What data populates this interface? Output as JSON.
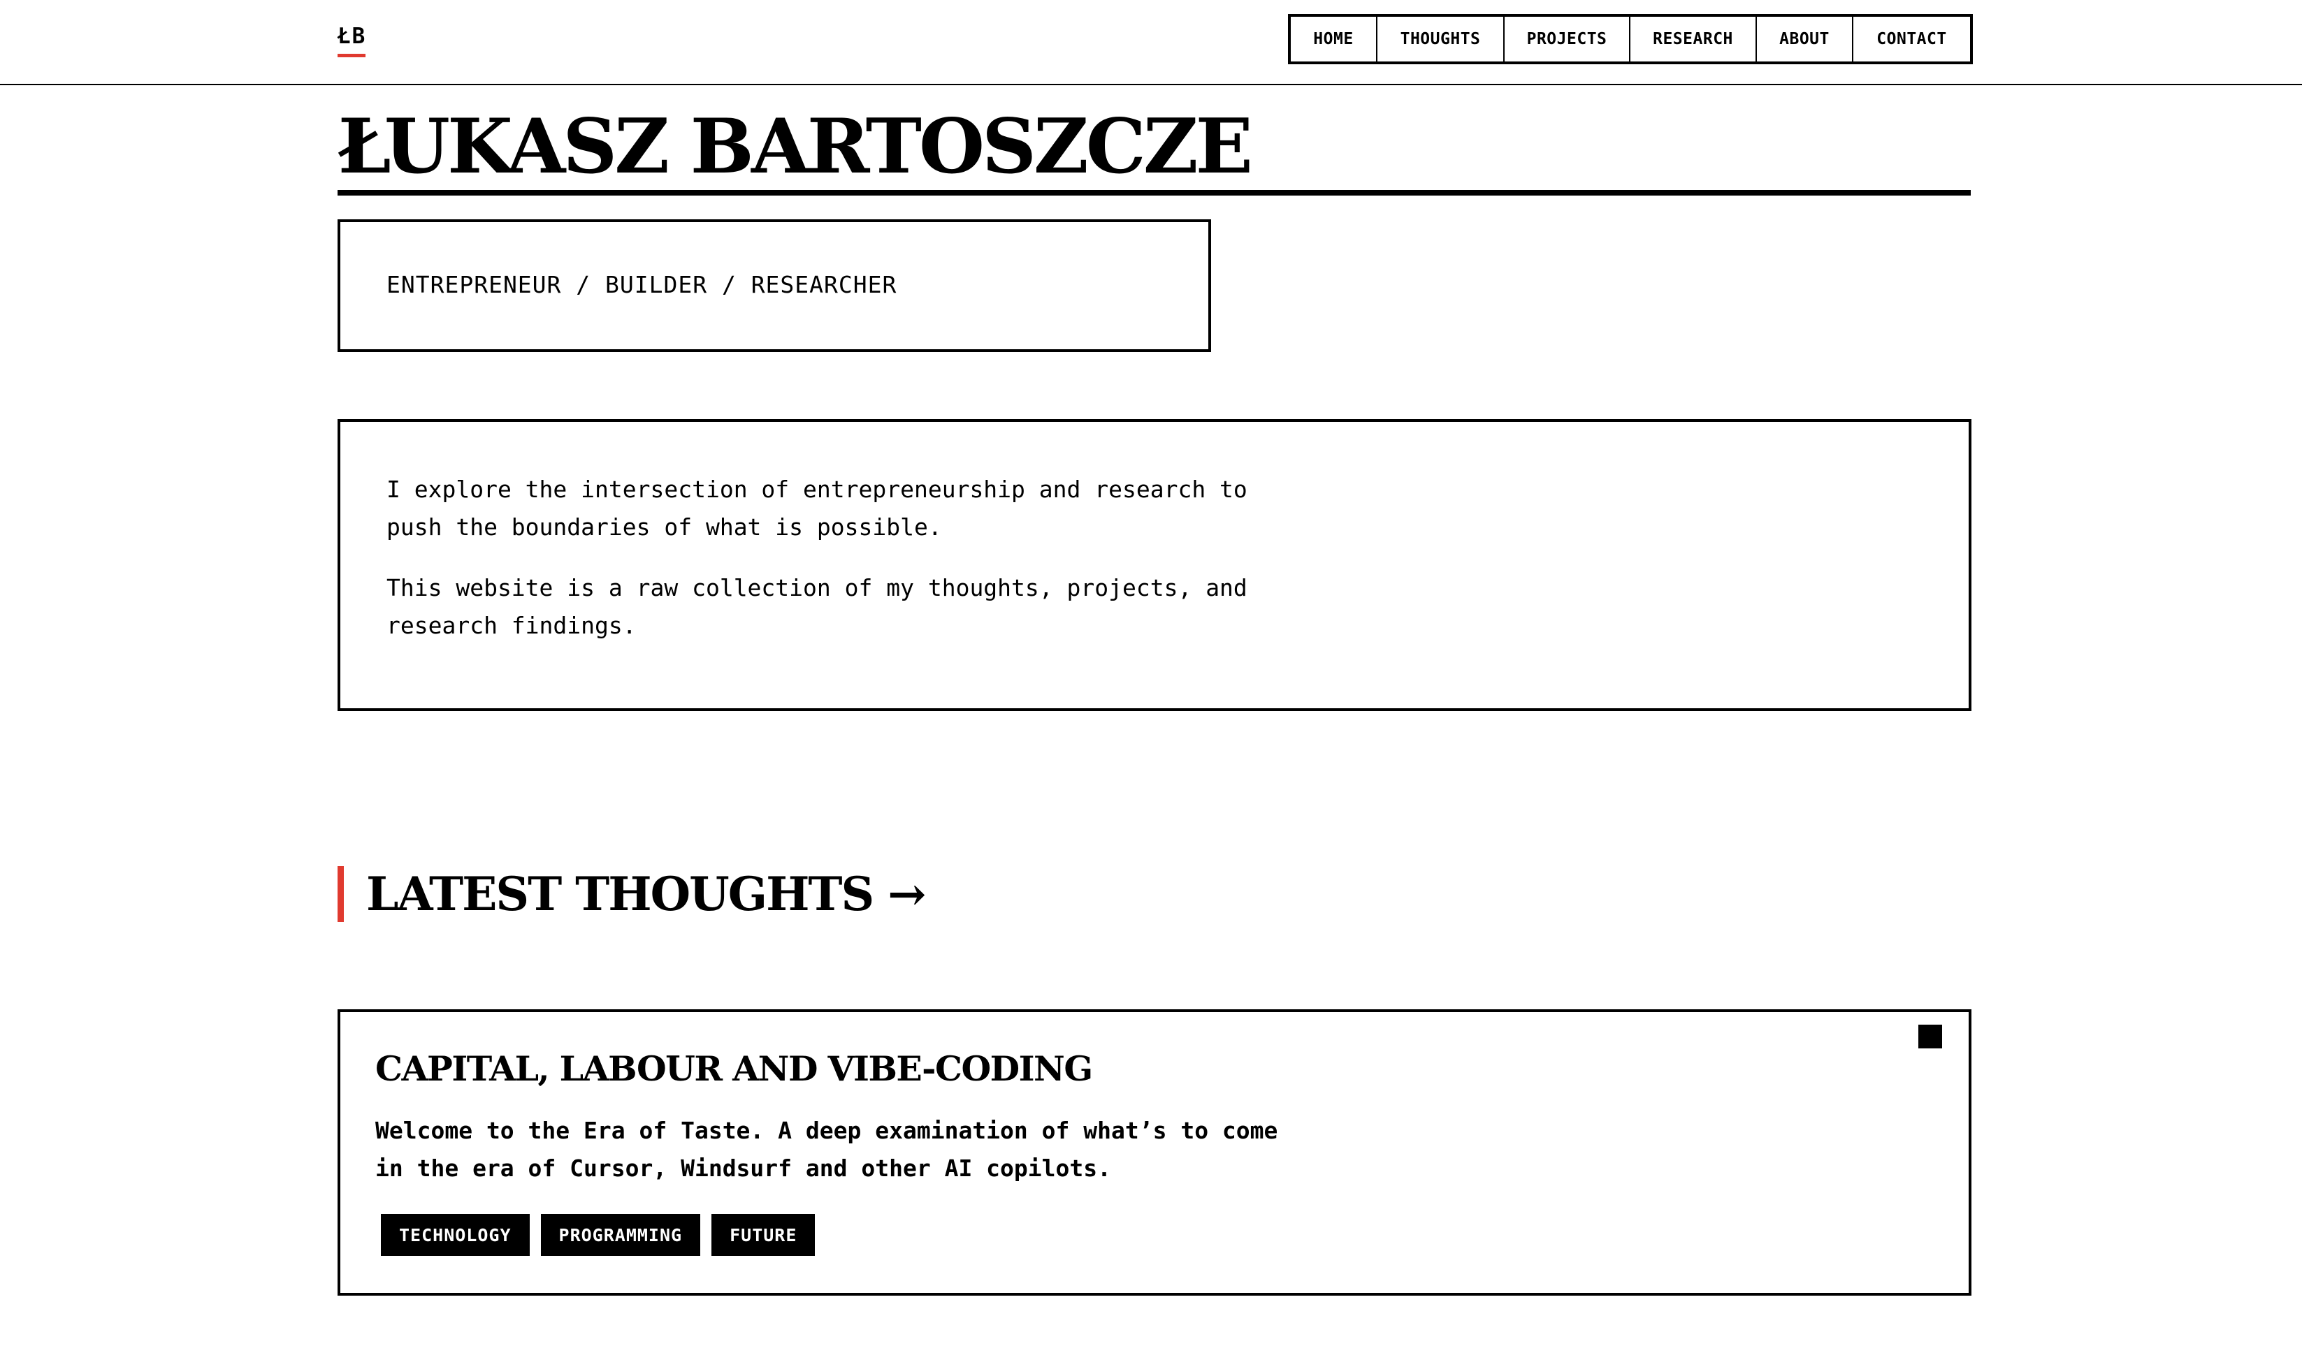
{
  "header": {
    "logo": "ŁB",
    "nav": [
      {
        "label": "HOME"
      },
      {
        "label": "THOUGHTS"
      },
      {
        "label": "PROJECTS"
      },
      {
        "label": "RESEARCH"
      },
      {
        "label": "ABOUT"
      },
      {
        "label": "CONTACT"
      }
    ]
  },
  "hero": {
    "title": "ŁUKASZ BARTOSZCZE",
    "tagline": "ENTREPRENEUR / BUILDER / RESEARCHER"
  },
  "intro": {
    "paragraphs": [
      "I explore the intersection of entrepreneurship and research to push the boundaries of what is possible.",
      "This website is a raw collection of my thoughts, projects, and research findings."
    ]
  },
  "latest_thoughts": {
    "heading": "LATEST THOUGHTS →",
    "items": [
      {
        "title": "CAPITAL, LABOUR AND VIBE-CODING",
        "description": "Welcome to the Era of Taste. A deep examination of what’s to come in the era of Cursor, Windsurf and other AI copilots.",
        "tags": [
          "TECHNOLOGY",
          "PROGRAMMING",
          "FUTURE"
        ]
      }
    ]
  },
  "colors": {
    "accent": "#e03a2f",
    "ink": "#000000",
    "background": "#ffffff"
  }
}
